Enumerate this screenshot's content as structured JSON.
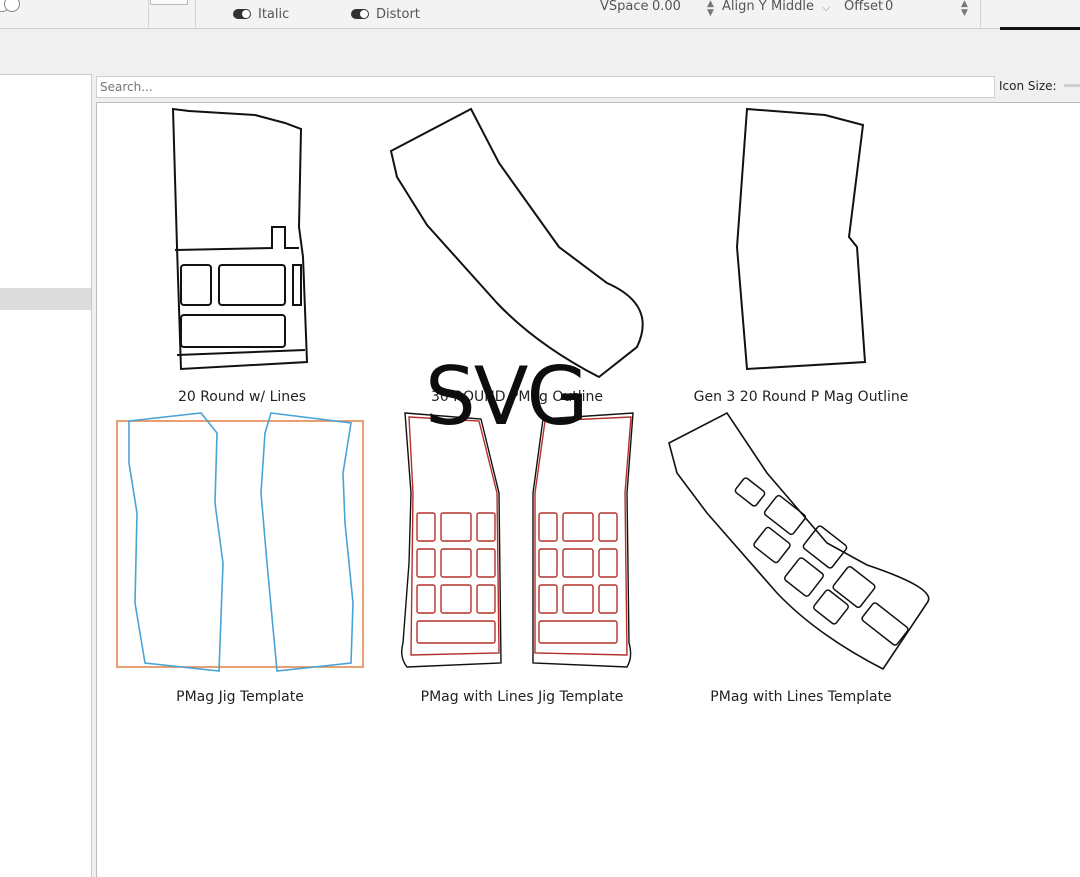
{
  "toolbar": {
    "italic_label": "Italic",
    "distort_label": "Distort",
    "vspace_label": "VSpace",
    "vspace_value": "0.00",
    "aligny_label": "Align Y",
    "aligny_value": "Middle",
    "offset_label": "Offset",
    "offset_value": "0"
  },
  "library": {
    "search_placeholder": "Search...",
    "icon_size_label": "Icon Size:",
    "items": [
      {
        "label": "20 Round w/ Lines"
      },
      {
        "label": "30 ROUND PMag Outline"
      },
      {
        "label": "Gen 3 20 Round P Mag Outline"
      },
      {
        "label": "PMag Jig Template"
      },
      {
        "label": "PMag with Lines Jig Template"
      },
      {
        "label": "PMag with Lines Template"
      }
    ]
  },
  "overlay_text": "SVG",
  "colors": {
    "outline_black": "#111111",
    "jig_blue": "#4aa3d4",
    "jig_orange": "#e3874f",
    "jig_red": "#b3302b"
  }
}
